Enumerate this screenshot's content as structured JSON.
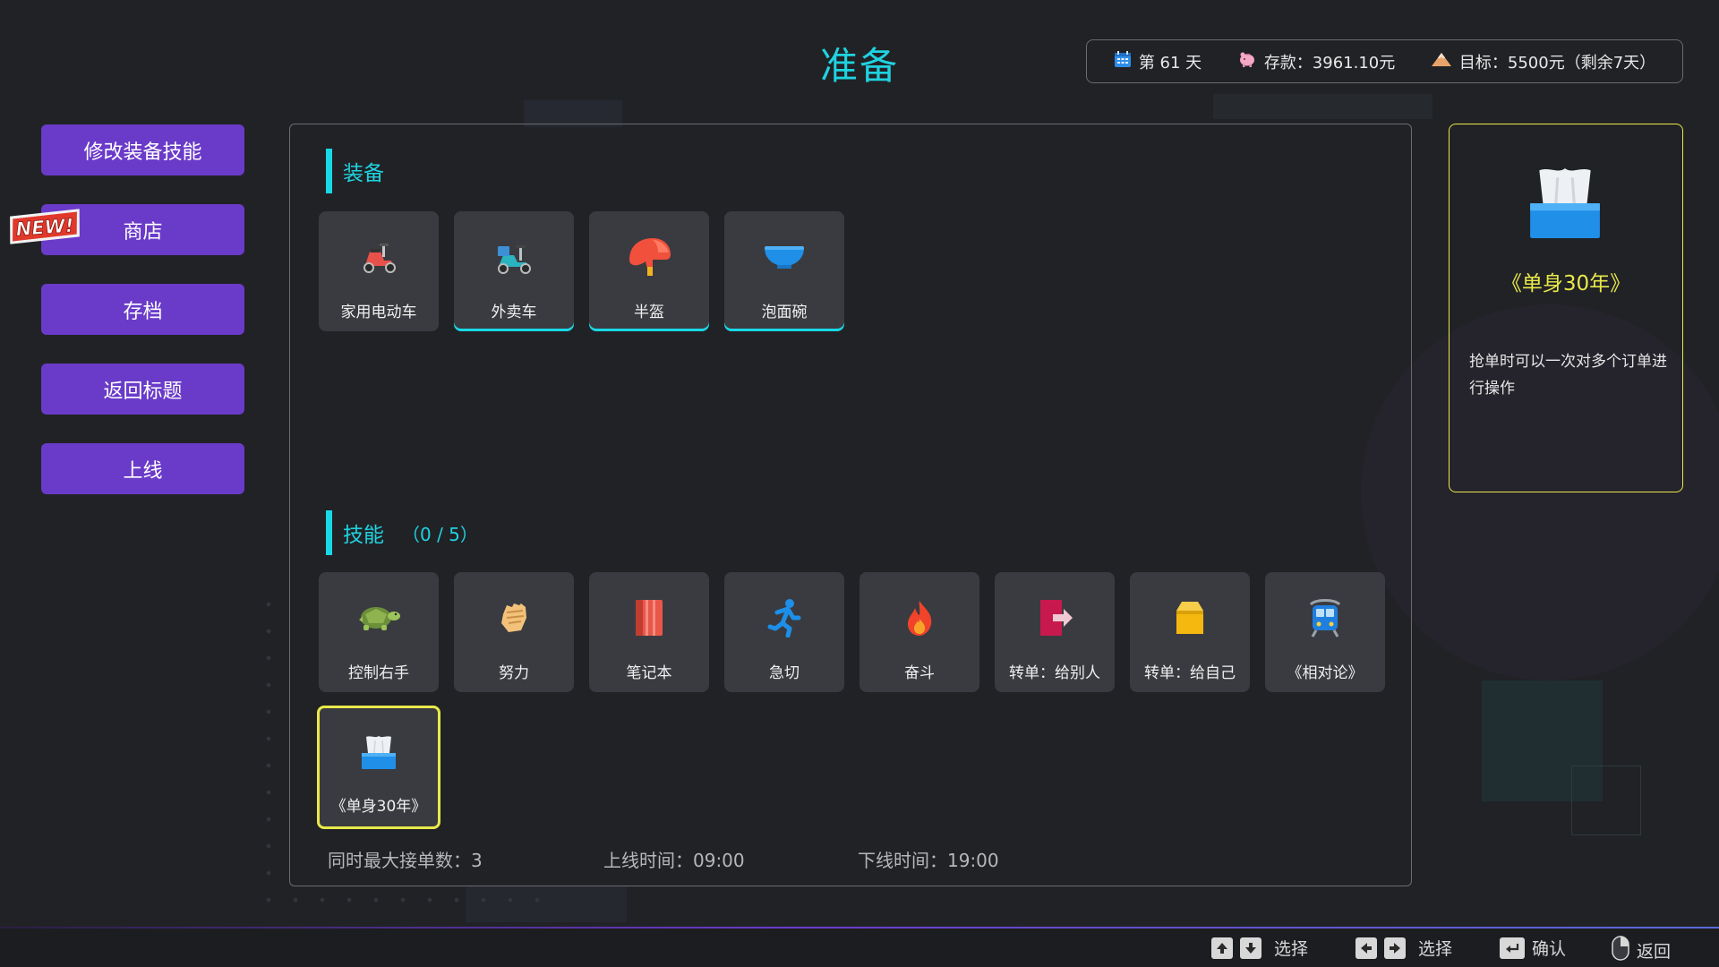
{
  "page": {
    "title": "准备"
  },
  "status": {
    "day": "第 61 天",
    "savings": "存款：3961.10元",
    "goal": "目标：5500元（剩余7天）"
  },
  "menu": {
    "items": [
      {
        "label": "修改装备技能"
      },
      {
        "label": "商店"
      },
      {
        "label": "存档"
      },
      {
        "label": "返回标题"
      },
      {
        "label": "上线"
      }
    ],
    "new_badge": "NEW!"
  },
  "equipment": {
    "heading": "装备",
    "items": [
      {
        "label": "家用电动车",
        "icon": "scooter-icon",
        "equipped": false
      },
      {
        "label": "外卖车",
        "icon": "delivery-scooter-icon",
        "equipped": true
      },
      {
        "label": "半盔",
        "icon": "helmet-icon",
        "equipped": true
      },
      {
        "label": "泡面碗",
        "icon": "bowl-icon",
        "equipped": true
      }
    ]
  },
  "skills": {
    "heading": "技能",
    "count": "（0 / 5）",
    "items": [
      {
        "label": "控制右手",
        "icon": "turtle-icon"
      },
      {
        "label": "努力",
        "icon": "fist-icon"
      },
      {
        "label": "笔记本",
        "icon": "notebook-icon"
      },
      {
        "label": "急切",
        "icon": "runner-icon"
      },
      {
        "label": "奋斗",
        "icon": "fire-icon"
      },
      {
        "label": "转单：给别人",
        "icon": "exit-door-icon"
      },
      {
        "label": "转单：给自己",
        "icon": "box-icon"
      },
      {
        "label": "《相对论》",
        "icon": "train-icon"
      },
      {
        "label": "《单身30年》",
        "icon": "tissue-box-icon",
        "selected": true
      }
    ]
  },
  "stats": {
    "max_orders": "同时最大接单数：3",
    "online_time": "上线时间：09:00",
    "offline_time": "下线时间：19:00"
  },
  "detail": {
    "title": "《单身30年》",
    "description": "抢单时可以一次对多个订单进行操作",
    "icon": "tissue-box-icon"
  },
  "hints": {
    "updown": "选择",
    "leftright": "选择",
    "confirm": "确认",
    "back": "返回"
  },
  "colors": {
    "accent": "#1fd3e0",
    "menu_button": "#6a3bc9",
    "selection": "#e8e94a",
    "background": "#212226",
    "card": "#3a3b40"
  }
}
